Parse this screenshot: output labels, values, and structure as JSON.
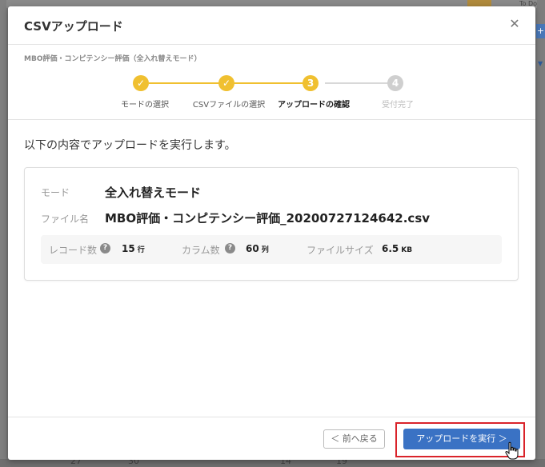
{
  "background": {
    "todo_label": "To Do",
    "plus_label": "+",
    "bottom_counts": [
      "27",
      "30",
      "14",
      "19"
    ]
  },
  "dialog": {
    "title": "CSVアップロード",
    "breadcrumb": "MBO評価・コンピテンシー評価（全入れ替えモード）",
    "steps": [
      {
        "label": "モードの選択",
        "number": "1",
        "state": "done"
      },
      {
        "label": "CSVファイルの選択",
        "number": "2",
        "state": "done"
      },
      {
        "label": "アップロードの確認",
        "number": "3",
        "state": "current"
      },
      {
        "label": "受付完了",
        "number": "4",
        "state": "pending"
      }
    ],
    "intro": "以下の内容でアップロードを実行します。",
    "mode_label": "モード",
    "mode_value": "全入れ替えモード",
    "file_label": "ファイル名",
    "file_value": "MBO評価・コンピテンシー評価_20200727124642.csv",
    "stats": {
      "records_label": "レコード数",
      "records_value": "15",
      "records_unit": "行",
      "columns_label": "カラム数",
      "columns_value": "60",
      "columns_unit": "列",
      "size_label": "ファイルサイズ",
      "size_value": "6.5",
      "size_unit": "KB"
    },
    "back_button": "＜ 前へ戻る",
    "execute_button": "アップロードを実行 ＞"
  },
  "colors": {
    "step_done": "#f0c030",
    "step_pending": "#cfcfcf",
    "primary": "#3a72c4",
    "highlight": "#d9232a"
  },
  "icons": {
    "close": "close-icon",
    "check": "check-icon",
    "help": "help-icon",
    "cursor": "hand-pointer-icon"
  }
}
